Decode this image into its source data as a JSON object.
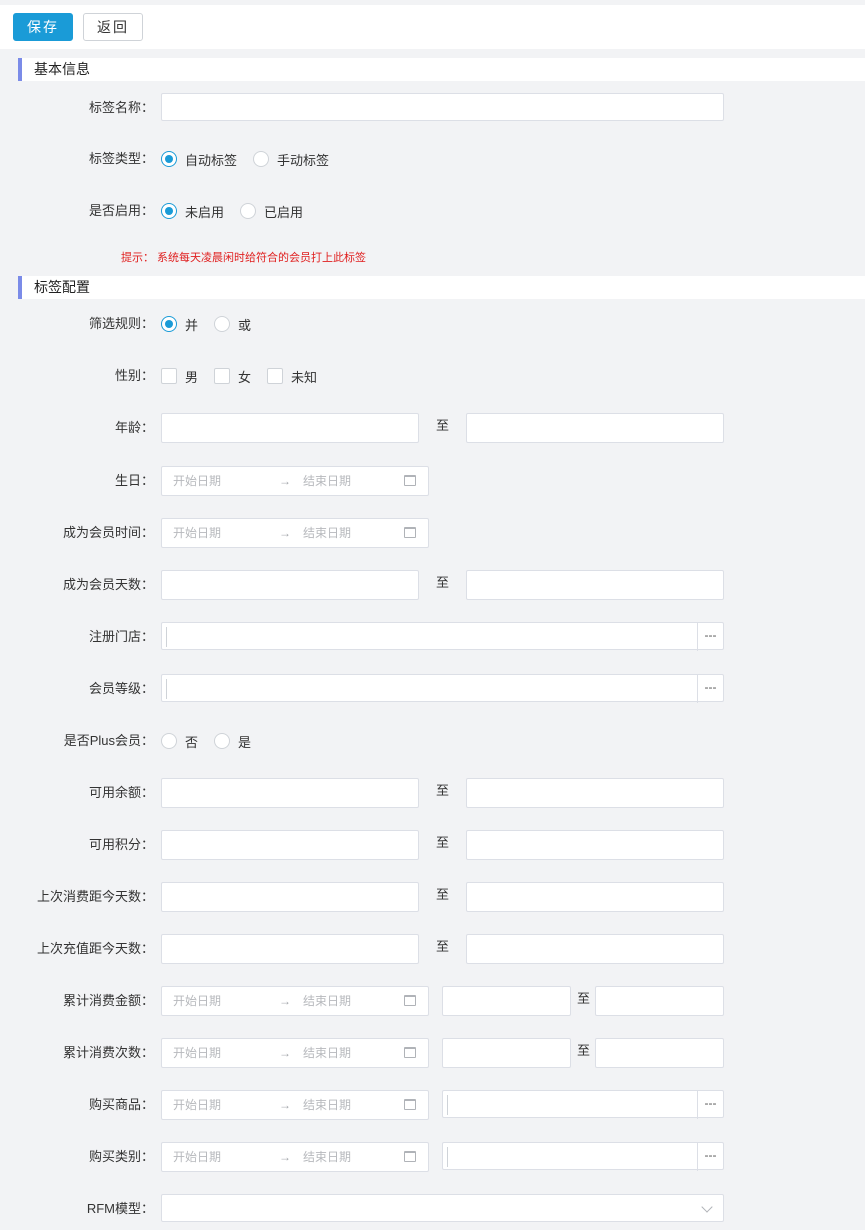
{
  "toolbar": {
    "save_label": "保存",
    "back_label": "返回"
  },
  "sections": {
    "basic": "基本信息",
    "config": "标签配置"
  },
  "basic": {
    "tag_name_label": "标签名称：",
    "tag_type_label": "标签类型：",
    "tag_type_options": [
      "自动标签",
      "手动标签"
    ],
    "tag_type_selected": "自动标签",
    "enabled_label": "是否启用：",
    "enabled_options": [
      "未启用",
      "已启用"
    ],
    "enabled_selected": "未启用",
    "hint": "提示：  系统每天凌晨闲时给符合的会员打上此标签"
  },
  "config": {
    "rule_label": "筛选规则：",
    "rule_options": [
      "并",
      "或"
    ],
    "rule_selected": "并",
    "gender_label": "性别：",
    "gender_options": [
      "男",
      "女",
      "未知"
    ],
    "age_label": "年龄：",
    "birthday_label": "生日：",
    "member_time_label": "成为会员时间：",
    "member_days_label": "成为会员天数：",
    "store_label": "注册门店：",
    "level_label": "会员等级：",
    "plus_label": "是否Plus会员：",
    "plus_options": [
      "否",
      "是"
    ],
    "balance_label": "可用余额：",
    "points_label": "可用积分：",
    "last_consume_label": "上次消费距今天数：",
    "last_recharge_label": "上次充值距今天数：",
    "total_amount_label": "累计消费金额：",
    "total_count_label": "累计消费次数：",
    "goods_label": "购买商品：",
    "category_label": "购买类别：",
    "rfm_label": "RFM模型："
  },
  "common": {
    "to": "至",
    "start_placeholder": "开始日期",
    "end_placeholder": "结束日期",
    "arrow": "→",
    "lookup_dots": "---"
  },
  "colors": {
    "primary": "#1a9bd7",
    "section_accent": "#7b8be8",
    "hint": "#e02020"
  }
}
